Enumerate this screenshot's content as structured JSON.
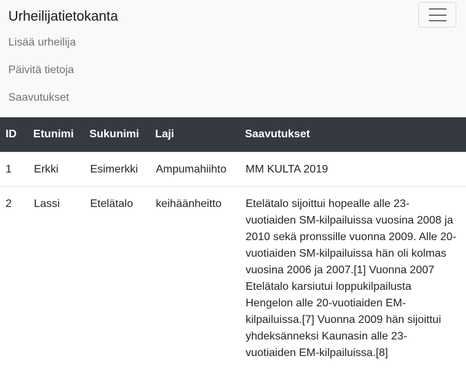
{
  "navbar": {
    "brand": "Urheilijatietokanta",
    "links": [
      "Lisää urheilija",
      "Päivitä tietoja",
      "Saavutukset"
    ]
  },
  "table": {
    "headers": [
      "ID",
      "Etunimi",
      "Sukunimi",
      "Laji",
      "Saavutukset"
    ],
    "rows": [
      {
        "id": "1",
        "etunimi": "Erkki",
        "sukunimi": "Esimerkki",
        "laji": "Ampumahiihto",
        "saavutukset": "MM KULTA 2019"
      },
      {
        "id": "2",
        "etunimi": "Lassi",
        "sukunimi": "Etelätalo",
        "laji": "keihäänheitto",
        "saavutukset": "Etelätalo sijoittui hopealle alle 23-vuotiaiden SM-kilpailuissa vuosina 2008 ja 2010 sekä pronssille vuonna 2009. Alle 20-vuotiaiden SM-kilpailuissa hän oli kolmas vuosina 2006 ja 2007.[1] Vuonna 2007 Etelätalo karsiutui loppukilpailusta Hengelon alle 20-vuotiaiden EM-kilpailuissa.[7] Vuonna 2009 hän sijoittui yhdeksänneksi Kaunasin alle 23-vuotiaiden EM-kilpailuissa.[8]"
      }
    ]
  },
  "colors": {
    "navbar_bg": "#f8f9fa",
    "header_bg": "#343a40",
    "header_text": "#ffffff"
  }
}
